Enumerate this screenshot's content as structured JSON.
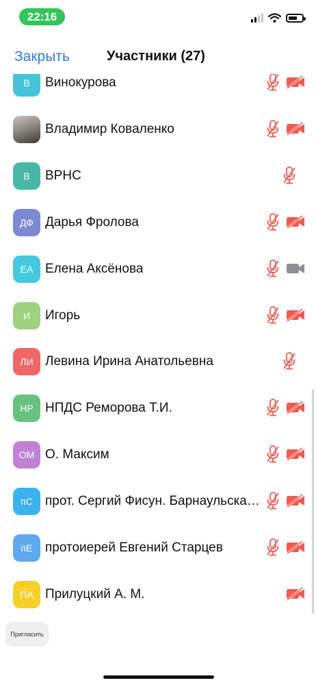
{
  "status_bar": {
    "time": "22:16"
  },
  "nav": {
    "close_label": "Закрыть",
    "title": "Участники (27)"
  },
  "colors": {
    "accent": "#2f7bd8",
    "muted_red": "#f05a4f",
    "muted_gray": "#8e8e93",
    "time_pill": "#33c45a"
  },
  "participants": [
    {
      "initials": "В",
      "name": "Винокурова",
      "avatar_color": "#45c4d9",
      "mic": "muted",
      "cam": "off"
    },
    {
      "initials": "",
      "name": "Владимир Коваленко",
      "avatar_color": "",
      "photo": true,
      "mic": "muted",
      "cam": "off"
    },
    {
      "initials": "В",
      "name": "ВРНС",
      "avatar_color": "#47b8a6",
      "mic": "muted",
      "cam": "none"
    },
    {
      "initials": "ДФ",
      "name": "Дарья Фролова",
      "avatar_color": "#7c8ad3",
      "mic": "muted",
      "cam": "off"
    },
    {
      "initials": "ЕА",
      "name": "Елена Аксёнова",
      "avatar_color": "#45c9de",
      "mic": "muted",
      "cam": "on"
    },
    {
      "initials": "И",
      "name": "Игорь",
      "avatar_color": "#9fd17f",
      "mic": "muted",
      "cam": "off"
    },
    {
      "initials": "ЛИ",
      "name": "Левина Ирина Анатольевна",
      "avatar_color": "#f16668",
      "mic": "muted",
      "cam": "none"
    },
    {
      "initials": "НР",
      "name": "НПДС Реморова Т.И.",
      "avatar_color": "#67c27e",
      "mic": "muted",
      "cam": "off"
    },
    {
      "initials": "ОМ",
      "name": "О. Максим",
      "avatar_color": "#bf82d4",
      "mic": "muted",
      "cam": "off"
    },
    {
      "initials": "пС",
      "name": "прот. Сергий Фисун. Барнаульская епархия",
      "avatar_color": "#3cb2ee",
      "mic": "muted",
      "cam": "off"
    },
    {
      "initials": "пЕ",
      "name": "протоиерей Евгений Старцев",
      "avatar_color": "#5fa9ef",
      "mic": "muted",
      "cam": "off"
    },
    {
      "initials": "ПА",
      "name": "Прилуцкий А. М.",
      "avatar_color": "#f7d12a",
      "mic": "none",
      "cam": "off"
    }
  ],
  "footer": {
    "invite_label": "Пригласить"
  }
}
